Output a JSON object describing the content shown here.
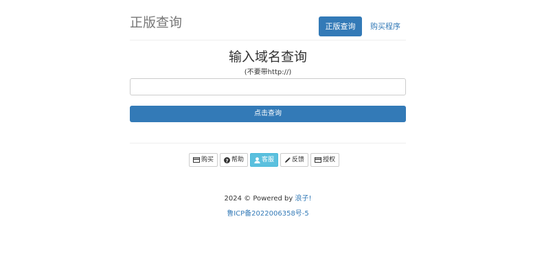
{
  "header": {
    "title": "正版查询",
    "nav_active": "正版查询",
    "nav_buy": "购买程序"
  },
  "query": {
    "title": "输入域名查询",
    "hint": "(不要带http://)",
    "input_value": "",
    "input_placeholder": "",
    "submit_label": "点击查询"
  },
  "actions": [
    {
      "label": "购买",
      "icon": "card-icon"
    },
    {
      "label": "帮助",
      "icon": "question-circle-icon"
    },
    {
      "label": "客服",
      "icon": "user-icon"
    },
    {
      "label": "反馈",
      "icon": "pencil-icon"
    },
    {
      "label": "授权",
      "icon": "card-icon"
    }
  ],
  "footer": {
    "copyright_prefix": "2024 © Powered by ",
    "author": "浪子!",
    "icp": "鲁ICP备2022006358号-5"
  },
  "colors": {
    "primary": "#337ab7",
    "info": "#5bc0de"
  }
}
